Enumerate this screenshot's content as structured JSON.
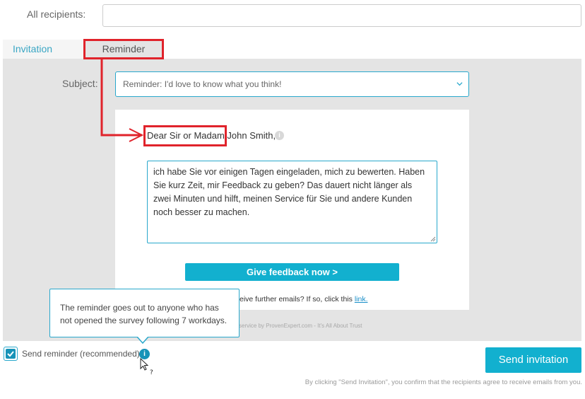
{
  "recipients": {
    "label": "All recipients:",
    "value": ""
  },
  "tabs": [
    {
      "label": "Invitation",
      "active": false
    },
    {
      "label": "Reminder",
      "active": true
    }
  ],
  "subject": {
    "label": "Subject:",
    "value": "Reminder: I'd love to know what you think!"
  },
  "email": {
    "greeting_highlighted": "Dear Sir or Madam",
    "greeting_rest": " John Smith,",
    "body": "ich habe Sie vor einigen Tagen eingeladen, mich zu bewerten. Haben Sie kurz Zeit, mir Feedback zu geben? Das dauert nicht länger als zwei Minuten und hilft, meinen Service für Sie und andere Kunden noch besser zu machen.",
    "feedback_button": "Give feedback now >",
    "unsubscribe_text": "eive further emails? If so, click this ",
    "unsubscribe_link": "link.",
    "powered_by": "service by ProvenExpert.com - It's All About Trust"
  },
  "tooltip": {
    "text": "The reminder goes out to anyone who has not opened the survey following 7 workdays."
  },
  "reminder_option": {
    "label": "Send reminder (recommended)",
    "checked": true
  },
  "send_button": "Send invitation",
  "disclaimer": "By clicking \"Send Invitation\", you confirm that the recipients agree to receive emails from you.",
  "colors": {
    "accent": "#12b0cf",
    "highlight": "#e0232b",
    "panel": "#e4e4e4"
  }
}
